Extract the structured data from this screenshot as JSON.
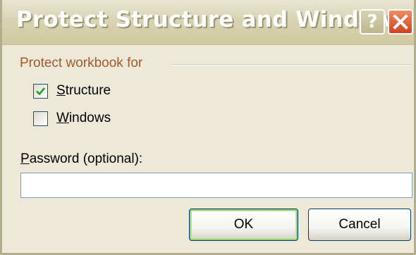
{
  "window": {
    "title": "Protect Structure and Windows",
    "help_glyph": "?",
    "close_icon": "close-icon"
  },
  "group": {
    "label": "Protect workbook for",
    "label_color": "#a35a2a"
  },
  "options": [
    {
      "label_accel": "S",
      "label_rest": "tructure",
      "checked": true
    },
    {
      "label_accel": "W",
      "label_rest": "indows",
      "checked": false
    }
  ],
  "password": {
    "label_accel": "P",
    "label_rest": "assword (optional):",
    "value": ""
  },
  "buttons": {
    "ok_label": "OK",
    "cancel_label": "Cancel"
  },
  "colors": {
    "dialog_bg": "#ece9d8",
    "close_red": "#d0431c",
    "default_button_glow": "#96cf6f",
    "check_mark": "#21a121"
  }
}
